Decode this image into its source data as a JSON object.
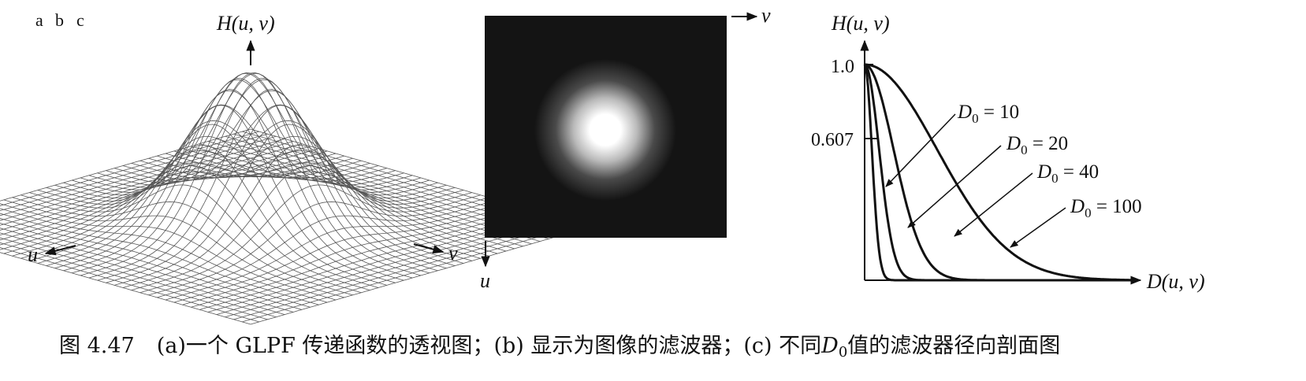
{
  "panel_labels": [
    "a",
    "b",
    "c"
  ],
  "panel_a": {
    "z_axis_label": "H(u, v)",
    "left_axis_label": "u",
    "right_axis_label": "v"
  },
  "panel_b": {
    "v_axis_label": "v",
    "u_axis_label": "u"
  },
  "chart_data": {
    "type": "line",
    "title": "",
    "ylabel": "H(u, v)",
    "xlabel": "D(u, v)",
    "yticks": [
      "1.0",
      "0.607"
    ],
    "ylim": [
      0,
      1.0
    ],
    "xlim": [
      0,
      370
    ],
    "function": "H = exp(-D^2 / (2*D0^2))",
    "series": [
      {
        "name": "D_0 = 10",
        "D0": 10
      },
      {
        "name": "D_0 = 20",
        "D0": 20
      },
      {
        "name": "D_0 = 40",
        "D0": 40
      },
      {
        "name": "D_0 = 100",
        "D0": 100
      }
    ],
    "annotations": [
      {
        "symbol": "D",
        "sub": "0",
        "rest": " = 10"
      },
      {
        "symbol": "D",
        "sub": "0",
        "rest": " = 20"
      },
      {
        "symbol": "D",
        "sub": "0",
        "rest": " = 40"
      },
      {
        "symbol": "D",
        "sub": "0",
        "rest": " = 100"
      }
    ]
  },
  "caption": {
    "figure_number": "图 4.47",
    "part_a": "(a)一个 GLPF 传递函数的透视图；",
    "part_b": "(b) 显示为图像的滤波器；",
    "part_c_pre": "(c) 不同 ",
    "part_c_sym": "D",
    "part_c_sub": "0",
    "part_c_post": " 值的滤波器径向剖面图"
  }
}
